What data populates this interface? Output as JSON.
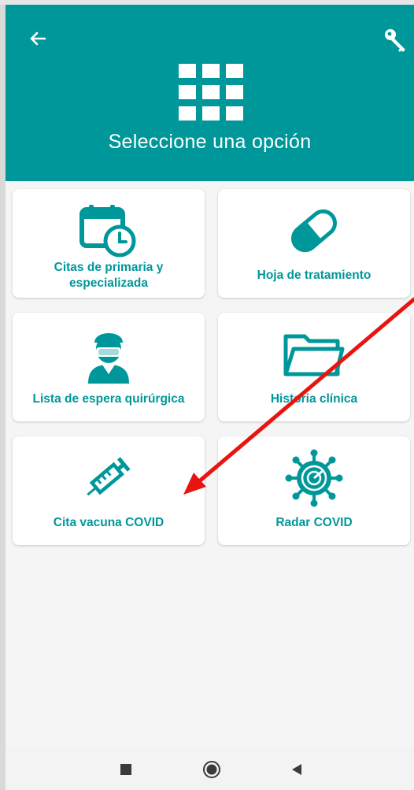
{
  "header": {
    "title": "Seleccione una opción",
    "back_icon": "arrow-left-icon",
    "key_icon": "key-icon",
    "menu_icon": "grid-icon"
  },
  "options": [
    {
      "label": "Citas de primaria y especializada",
      "icon": "calendar-clock-icon"
    },
    {
      "label": "Hoja de tratamiento",
      "icon": "pill-icon"
    },
    {
      "label": "Lista de espera quirúrgica",
      "icon": "surgeon-icon"
    },
    {
      "label": "Historia clínica",
      "icon": "folder-icon"
    },
    {
      "label": "Cita vacuna COVID",
      "icon": "syringe-icon"
    },
    {
      "label": "Radar COVID",
      "icon": "virus-radar-icon"
    }
  ],
  "navbar": {
    "recent_icon": "square-icon",
    "home_icon": "circle-icon",
    "back_icon": "triangle-left-icon"
  },
  "colors": {
    "primary": "#00979a",
    "annotation": "#e8140f",
    "background": "#f5f5f5"
  }
}
